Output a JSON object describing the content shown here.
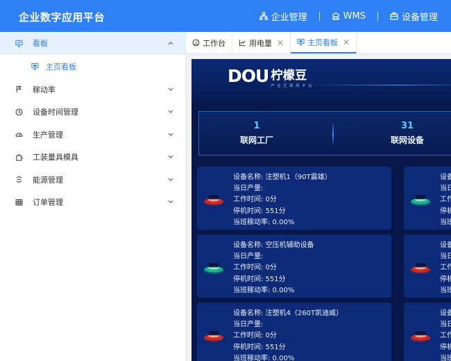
{
  "header": {
    "brand": "企业数字应用平台",
    "nav": [
      {
        "label": "企业管理",
        "icon": "org-tree-icon"
      },
      {
        "label": "WMS",
        "icon": "warehouse-icon"
      },
      {
        "label": "设备管理",
        "icon": "briefcase-icon"
      }
    ]
  },
  "sidebar": {
    "items": [
      {
        "label": "看板",
        "icon": "monitor-icon",
        "expanded": true,
        "active": true
      },
      {
        "label": "主页看板",
        "icon": "screen-icon",
        "sub": true
      },
      {
        "label": "稼动率",
        "icon": "flag-icon"
      },
      {
        "label": "设备时间管理",
        "icon": "clock-icon"
      },
      {
        "label": "生产管理",
        "icon": "gauge-icon"
      },
      {
        "label": "工装量具模具",
        "icon": "puzzle-icon"
      },
      {
        "label": "能源管理",
        "icon": "energy-icon"
      },
      {
        "label": "订单管理",
        "icon": "grid-icon"
      }
    ]
  },
  "tabs": [
    {
      "label": "工作台",
      "icon": "dashboard-icon",
      "closable": false
    },
    {
      "label": "用电量",
      "icon": "line-chart-icon",
      "closable": true
    },
    {
      "label": "主页看板",
      "icon": "screen-icon",
      "closable": true,
      "active": true
    }
  ],
  "dashboard": {
    "logo_text": "DOU",
    "company": "柠檬豆",
    "tagline": "产业互联网平台",
    "stats": [
      {
        "value": "1",
        "label": "联网工厂"
      },
      {
        "value": "31",
        "label": "联网设备"
      }
    ],
    "labels": {
      "name": "设备名称: ",
      "output": "当日产量:",
      "work": "工作时间: ",
      "stop": "停机时间: ",
      "rate": "当班稼动率: "
    },
    "left_cards": [
      {
        "name": "注塑机1（90T震雄）",
        "output": "",
        "work": "0分",
        "stop": "551分",
        "rate": "0.00%",
        "status": "red"
      },
      {
        "name": "空压机辅助设备",
        "output": "",
        "work": "0分",
        "stop": "551分",
        "rate": "0.00%",
        "status": "green"
      },
      {
        "name": "注塑机4（260T凯迪威）",
        "output": "",
        "work": "0分",
        "stop": "551分",
        "rate": "0.00%",
        "status": "red"
      }
    ],
    "right_cards": [
      {
        "name_partial": "设备",
        "l2": "当日",
        "l3": "工作",
        "l4": "停机",
        "l5": "当班",
        "status": "green"
      },
      {
        "name_partial": "设备",
        "l2": "当日",
        "l3": "工作",
        "l4": "停机",
        "l5": "当班",
        "status": "red"
      },
      {
        "name_partial": "设备",
        "l2": "当日",
        "l3": "工作",
        "l4": "停机",
        "l5": "当班",
        "status": "red"
      }
    ],
    "colors": {
      "red": "#d42a1e",
      "green": "#16b787"
    }
  }
}
